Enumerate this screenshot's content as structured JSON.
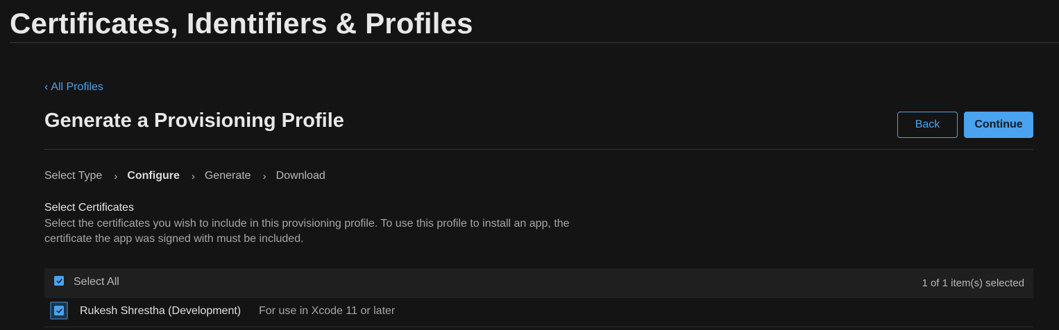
{
  "header": {
    "title": "Certificates, Identifiers & Profiles"
  },
  "nav": {
    "back_chevron": "‹",
    "back_link": "All Profiles"
  },
  "page": {
    "heading": "Generate a Provisioning Profile",
    "back_button": "Back",
    "continue_button": "Continue"
  },
  "steps": {
    "items": [
      "Select Type",
      "Configure",
      "Generate",
      "Download"
    ],
    "active": "Configure",
    "separator": "›"
  },
  "certificates": {
    "title": "Select Certificates",
    "description": "Select the certificates you wish to include in this provisioning profile. To use this profile to install an app, the certificate the app was signed with must be included.",
    "select_all_label": "Select All",
    "select_all_checked": true,
    "selection_count": "1 of 1 item(s) selected",
    "rows": [
      {
        "name": "Rukesh Shrestha (Development)",
        "note": "For use in Xcode 11 or later",
        "checked": true
      }
    ]
  },
  "colors": {
    "accent": "#4aa3ef",
    "background": "#141414",
    "table_header": "#1f1f1f"
  }
}
